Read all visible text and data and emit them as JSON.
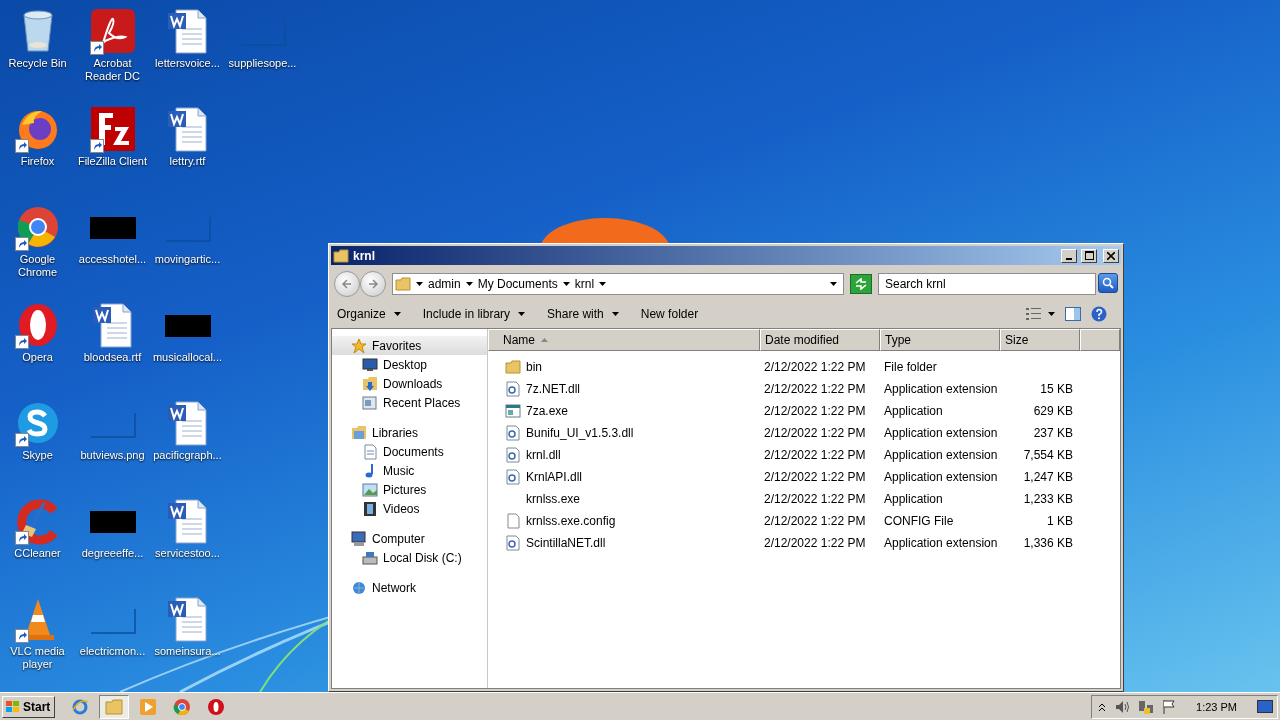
{
  "desktop": {
    "icons": [
      {
        "label": "Recycle Bin",
        "kind": "recycle",
        "shortcut": false
      },
      {
        "label": "Firefox",
        "kind": "firefox",
        "shortcut": true
      },
      {
        "label": "Google Chrome",
        "kind": "chrome",
        "shortcut": true
      },
      {
        "label": "Opera",
        "kind": "opera",
        "shortcut": true
      },
      {
        "label": "Skype",
        "kind": "skype",
        "shortcut": true
      },
      {
        "label": "CCleaner",
        "kind": "ccleaner",
        "shortcut": true
      },
      {
        "label": "VLC media player",
        "kind": "vlc",
        "shortcut": true
      },
      {
        "label": "Acrobat Reader DC",
        "kind": "acrobat",
        "shortcut": true
      },
      {
        "label": "FileZilla Client",
        "kind": "filezilla",
        "shortcut": true
      },
      {
        "label": "accesshotel...",
        "kind": "black",
        "shortcut": false
      },
      {
        "label": "bloodsea.rtf",
        "kind": "word",
        "shortcut": false
      },
      {
        "label": "butviews.png",
        "kind": "blank",
        "shortcut": false
      },
      {
        "label": "degreeeffe...",
        "kind": "black",
        "shortcut": false
      },
      {
        "label": "electricmon...",
        "kind": "blank",
        "shortcut": false
      },
      {
        "label": "lettersvoice...",
        "kind": "word",
        "shortcut": false
      },
      {
        "label": "lettry.rtf",
        "kind": "word",
        "shortcut": false
      },
      {
        "label": "movingartic...",
        "kind": "blank",
        "shortcut": false
      },
      {
        "label": "musicallocal...",
        "kind": "black",
        "shortcut": false
      },
      {
        "label": "pacificgraph...",
        "kind": "word",
        "shortcut": false
      },
      {
        "label": "servicestoo...",
        "kind": "word",
        "shortcut": false
      },
      {
        "label": "someinsura...",
        "kind": "word",
        "shortcut": false
      },
      {
        "label": "suppliesope...",
        "kind": "blank",
        "shortcut": false
      }
    ]
  },
  "window": {
    "title": "krnl",
    "breadcrumb": [
      "admin",
      "My Documents",
      "krnl"
    ],
    "search": {
      "placeholder": "Search krnl"
    },
    "commands": [
      {
        "label": "Organize",
        "dropdown": true
      },
      {
        "label": "Include in library",
        "dropdown": true
      },
      {
        "label": "Share with",
        "dropdown": true
      },
      {
        "label": "New folder",
        "dropdown": false
      }
    ],
    "navigation": [
      {
        "label": "Favorites",
        "kind": "star",
        "selected": true,
        "children": [
          {
            "label": "Desktop",
            "kind": "desktop",
            "selected": false
          },
          {
            "label": "Downloads",
            "kind": "downloads",
            "selected": false
          },
          {
            "label": "Recent Places",
            "kind": "recent",
            "selected": false
          }
        ]
      },
      {
        "label": "Libraries",
        "kind": "libraries",
        "selected": false,
        "children": [
          {
            "label": "Documents",
            "kind": "documents",
            "selected": false
          },
          {
            "label": "Music",
            "kind": "music",
            "selected": false
          },
          {
            "label": "Pictures",
            "kind": "pictures",
            "selected": false
          },
          {
            "label": "Videos",
            "kind": "videos",
            "selected": false
          }
        ]
      },
      {
        "label": "Computer",
        "kind": "computer",
        "selected": false,
        "children": [
          {
            "label": "Local Disk (C:)",
            "kind": "disk",
            "selected": false
          }
        ]
      },
      {
        "label": "Network",
        "kind": "network",
        "selected": false
      }
    ],
    "table": {
      "columns": [
        {
          "label": "Name",
          "sorted": true
        },
        {
          "label": "Date modified",
          "sorted": false
        },
        {
          "label": "Type",
          "sorted": false
        },
        {
          "label": "Size",
          "sorted": false
        }
      ],
      "rows": [
        {
          "name": "bin",
          "date": "2/12/2022 1:22 PM",
          "type": "File folder",
          "kind": "folder"
        },
        {
          "name": "7z.NET.dll",
          "date": "2/12/2022 1:22 PM",
          "type": "Application extension",
          "size": "15 KB",
          "kind": "dll"
        },
        {
          "name": "7za.exe",
          "date": "2/12/2022 1:22 PM",
          "type": "Application",
          "size": "629 KB",
          "kind": "exe"
        },
        {
          "name": "Bunifu_UI_v1.5.3.dll",
          "date": "2/12/2022 1:22 PM",
          "type": "Application extension",
          "size": "237 KB",
          "kind": "dll"
        },
        {
          "name": "krnl.dll",
          "date": "2/12/2022 1:22 PM",
          "type": "Application extension",
          "size": "7,554 KB",
          "kind": "dll"
        },
        {
          "name": "KrnlAPI.dll",
          "date": "2/12/2022 1:22 PM",
          "type": "Application extension",
          "size": "1,247 KB",
          "kind": "dll"
        },
        {
          "name": "krnlss.exe",
          "date": "2/12/2022 1:22 PM",
          "type": "Application",
          "size": "1,233 KB",
          "kind": "none"
        },
        {
          "name": "krnlss.exe.config",
          "date": "2/12/2022 1:22 PM",
          "type": "CONFIG File",
          "size": "1 KB",
          "kind": "file"
        },
        {
          "name": "ScintillaNET.dll",
          "date": "2/12/2022 1:22 PM",
          "type": "Application extension",
          "size": "1,336 KB",
          "kind": "dll"
        }
      ]
    }
  },
  "taskbar": {
    "start": "Start",
    "apps": [
      {
        "kind": "ie",
        "selected": false
      },
      {
        "kind": "explorer",
        "selected": true
      },
      {
        "kind": "media",
        "selected": false
      },
      {
        "kind": "chrome",
        "selected": false
      },
      {
        "kind": "opera",
        "selected": false
      }
    ],
    "clock": "1:23 PM"
  }
}
